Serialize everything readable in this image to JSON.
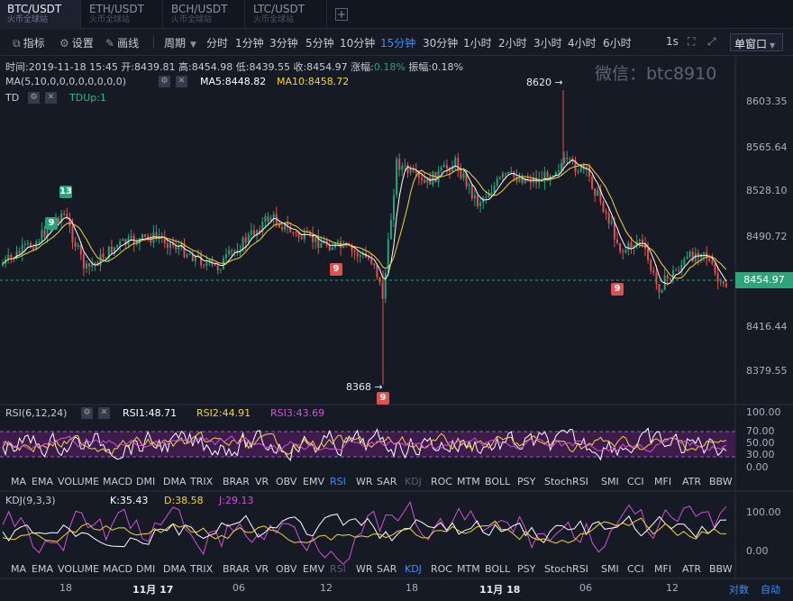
{
  "tabs": [
    {
      "symbol": "BTC/USDT",
      "exchange": "火币全球站",
      "active": true
    },
    {
      "symbol": "ETH/USDT",
      "exchange": "火币全球站",
      "active": false
    },
    {
      "symbol": "BCH/USDT",
      "exchange": "火币全球站",
      "active": false
    },
    {
      "symbol": "LTC/USDT",
      "exchange": "火币全球站",
      "active": false
    }
  ],
  "toolbar": {
    "indicators": "指标",
    "settings": "设置",
    "draw": "画线",
    "period_label": "周期",
    "periods": [
      "分时",
      "1分钟",
      "3分钟",
      "5分钟",
      "10分钟",
      "15分钟",
      "30分钟",
      "1小时",
      "2小时",
      "3小时",
      "4小时",
      "6小时"
    ],
    "active_period": "15分钟",
    "precision": "1s",
    "window_mode": "单窗口"
  },
  "ohlc": {
    "time": "时间:2019-11-18 15:45",
    "open": "开:8439.81",
    "high": "高:8454.98",
    "low": "低:8439.55",
    "close": "收:8454.97",
    "change_label": "涨幅:",
    "change_value": "0.18%",
    "amp_label": "振幅:",
    "amp_value": "0.18%"
  },
  "watermark": "微信：btc8910",
  "ma": {
    "label": "MA(5,10,0,0,0,0,0,0,0,0)",
    "ma5": "MA5:8448.82",
    "ma10": "MA10:8458.72"
  },
  "td": {
    "label": "TD",
    "value": "TDUp:1"
  },
  "price_axis": [
    "8603.35",
    "8565.64",
    "8528.10",
    "8490.72",
    "8416.44",
    "8379.55"
  ],
  "last_price": "8454.97",
  "markers": {
    "high": "8620",
    "low": "8368"
  },
  "rsi": {
    "label": "RSI(6,12,24)",
    "rsi1": "RSI1:48.71",
    "rsi2": "RSI2:44.91",
    "rsi3": "RSI3:43.69",
    "axis": [
      "100.00",
      "70.00",
      "50.00",
      "30.00",
      "0.00"
    ]
  },
  "kdj": {
    "label": "KDJ(9,3,3)",
    "k": "K:35.43",
    "d": "D:38.58",
    "j": "J:29.13",
    "axis": [
      "100.00",
      "0.00"
    ]
  },
  "indicator_tabs": [
    "MA",
    "EMA",
    "VOLUME",
    "MACD",
    "DMI",
    "DMA",
    "TRIX",
    "BRAR",
    "VR",
    "OBV",
    "EMV",
    "RSI",
    "WR",
    "SAR",
    "KDJ",
    "ROC",
    "MTM",
    "BOLL",
    "PSY",
    "StochRSI",
    "SMI",
    "CCI",
    "MFI",
    "ATR",
    "BBW"
  ],
  "time_axis": [
    "18",
    "11月 17",
    "06",
    "12",
    "18",
    "11月 18",
    "06",
    "12"
  ],
  "scale_log": "对数",
  "scale_auto": "自动",
  "colors": {
    "up": "#22a37a",
    "down": "#e0524f",
    "ma5": "#ffffff",
    "ma10": "#f2d43d",
    "accent": "#3d8dff"
  }
}
